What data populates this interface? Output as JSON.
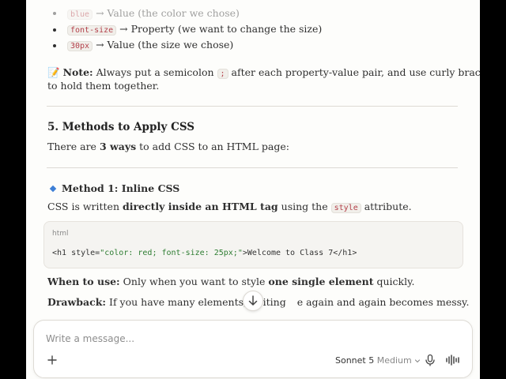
{
  "content": {
    "top_list": [
      {
        "code": "blue",
        "text": "→ Value (the color we chose)"
      },
      {
        "code": "font-size",
        "text": "→ Property (we want to change the size)"
      },
      {
        "code": "30px",
        "text": "→ Value (the size we chose)"
      }
    ],
    "note": {
      "emoji": "📝",
      "label": "Note:",
      "text1": "Always put a semicolon",
      "code1": ";",
      "text2": "after each property-value pair, and use curly braces",
      "code2": "{ }",
      "text3": "to hold them together."
    },
    "section5": {
      "heading": "5. Methods to Apply CSS",
      "intro_pre": "There are",
      "intro_bold": "3 ways",
      "intro_post": "to add CSS to an HTML page:"
    },
    "method1": {
      "heading": "Method 1: Inline CSS",
      "desc_pre": "CSS is written",
      "desc_bold": "directly inside an HTML tag",
      "desc_mid": "using the",
      "desc_code": "style",
      "desc_post": "attribute."
    },
    "code_block": {
      "language": "html",
      "line_tag_open": "<h1 style=",
      "line_attr": "\"color: red; font-size: 25px;\"",
      "line_rest": ">Welcome to Class 7</h1>"
    },
    "when_to_use": {
      "label": "When to use:",
      "pre": "Only when you want to style",
      "bold": "one single element",
      "post": "quickly."
    },
    "drawback": {
      "label": "Drawback:",
      "text_before": "If you have many elements, writing",
      "text_after": "e again and again becomes messy."
    }
  },
  "composer": {
    "placeholder": "Write a message...",
    "model_name": "Sonnet 5",
    "model_mode": "Medium"
  },
  "colors": {
    "accent": "#3d7fd6",
    "inline_code": "#b3404a",
    "code_string": "#2e7d32"
  }
}
